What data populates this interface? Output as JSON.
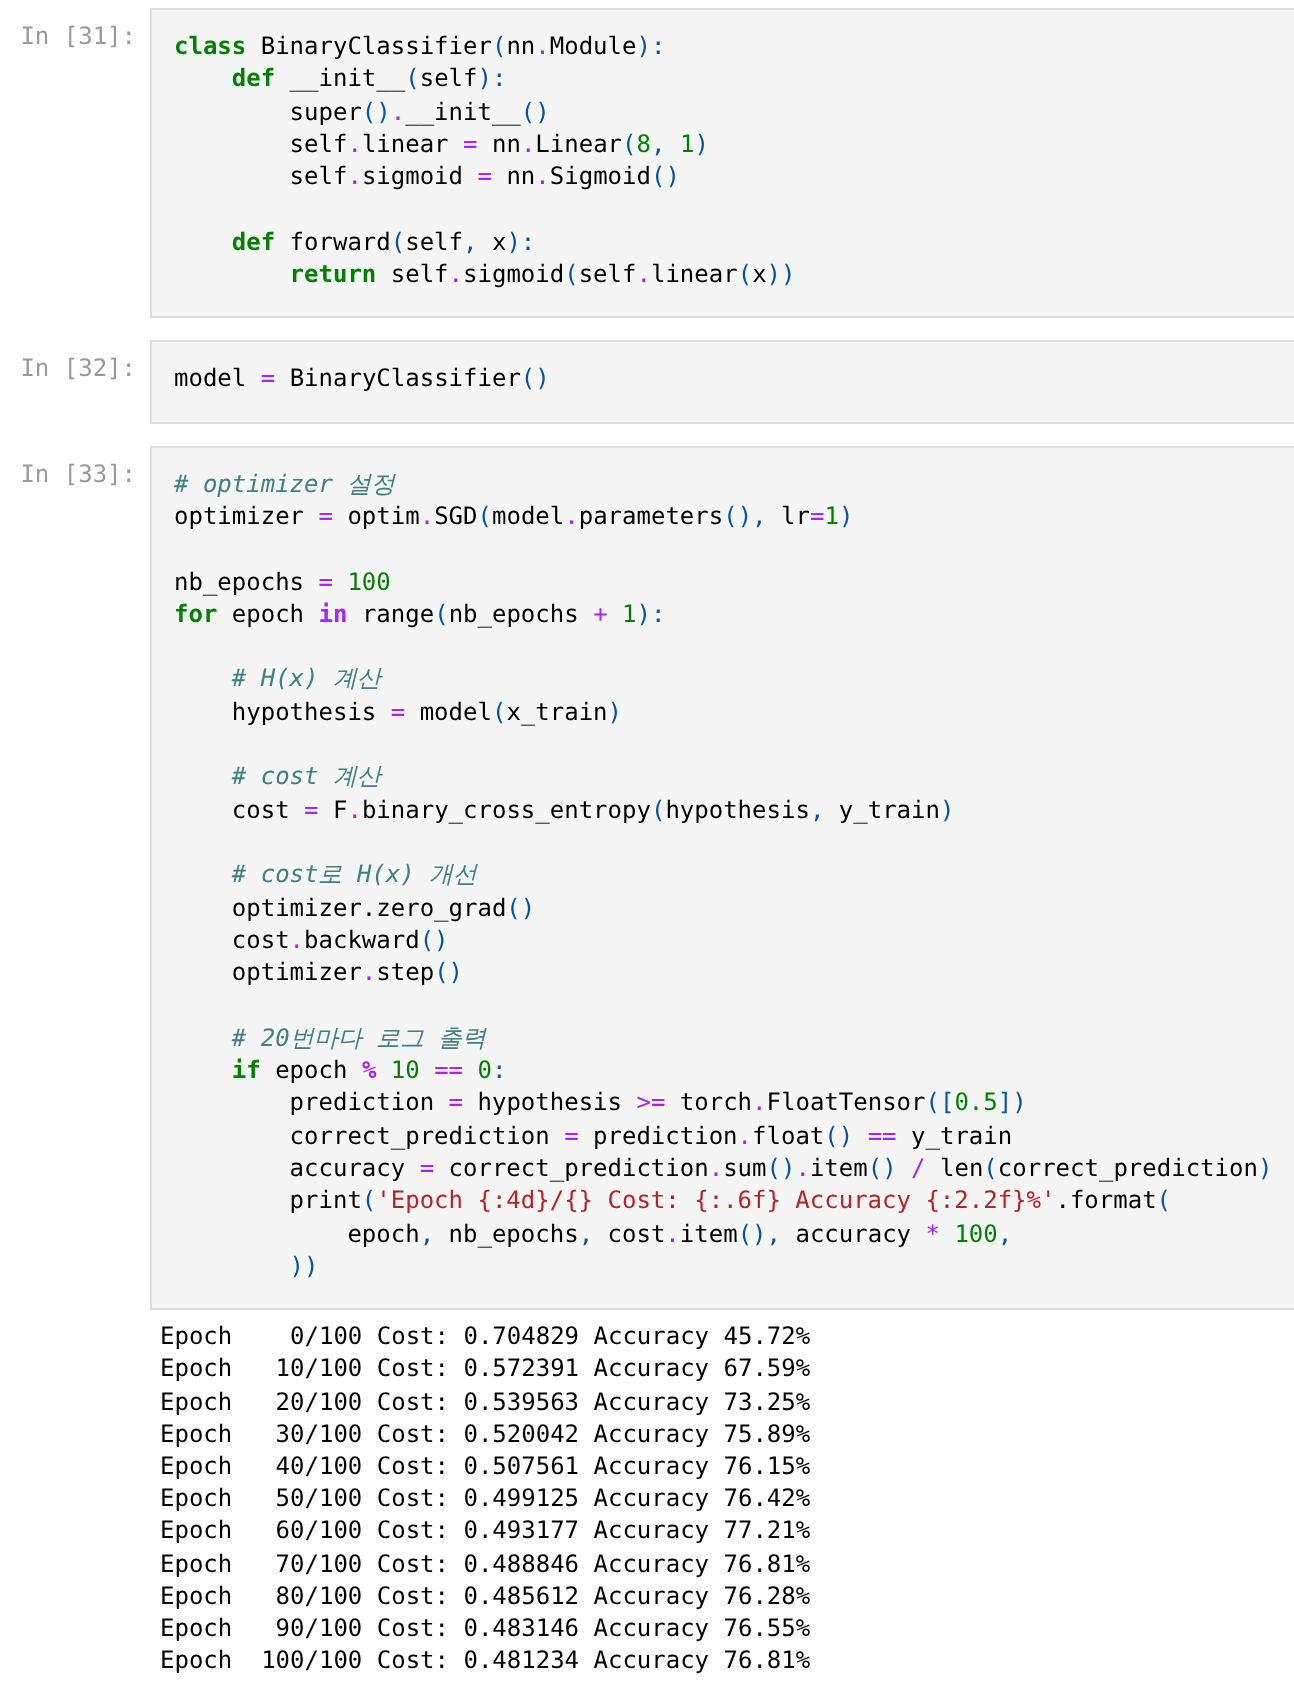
{
  "cells": [
    {
      "prompt": "In [31]:",
      "lines": [
        {
          "kind": "code",
          "tokens": [
            {
              "kind": "keyword",
              "text": "class"
            },
            {
              "kind": "plain",
              "text": " BinaryClassifier"
            },
            {
              "kind": "punct",
              "text": "("
            },
            {
              "kind": "plain",
              "text": "nn"
            },
            {
              "kind": "operator",
              "text": "."
            },
            {
              "kind": "plain",
              "text": "Module"
            },
            {
              "kind": "punct",
              "text": "):"
            }
          ]
        },
        {
          "kind": "code",
          "tokens": [
            {
              "kind": "keyword",
              "text": "    def"
            },
            {
              "kind": "plain",
              "text": " __init__"
            },
            {
              "kind": "punct",
              "text": "("
            },
            {
              "kind": "plain",
              "text": "self"
            },
            {
              "kind": "punct",
              "text": "):"
            }
          ]
        },
        {
          "kind": "code",
          "tokens": [
            {
              "kind": "plain",
              "text": "        super"
            },
            {
              "kind": "punct",
              "text": "()"
            },
            {
              "kind": "operator",
              "text": "."
            },
            {
              "kind": "plain",
              "text": "__init__"
            },
            {
              "kind": "punct",
              "text": "()"
            }
          ]
        },
        {
          "kind": "code",
          "tokens": [
            {
              "kind": "plain",
              "text": "        self"
            },
            {
              "kind": "operator",
              "text": "."
            },
            {
              "kind": "plain",
              "text": "linear "
            },
            {
              "kind": "operator",
              "text": "="
            },
            {
              "kind": "plain",
              "text": " nn"
            },
            {
              "kind": "operator",
              "text": "."
            },
            {
              "kind": "plain",
              "text": "Linear"
            },
            {
              "kind": "punct",
              "text": "("
            },
            {
              "kind": "number",
              "text": "8"
            },
            {
              "kind": "punct",
              "text": ", "
            },
            {
              "kind": "number",
              "text": "1"
            },
            {
              "kind": "punct",
              "text": ")"
            }
          ]
        },
        {
          "kind": "code",
          "tokens": [
            {
              "kind": "plain",
              "text": "        self"
            },
            {
              "kind": "operator",
              "text": "."
            },
            {
              "kind": "plain",
              "text": "sigmoid "
            },
            {
              "kind": "operator",
              "text": "="
            },
            {
              "kind": "plain",
              "text": " nn"
            },
            {
              "kind": "operator",
              "text": "."
            },
            {
              "kind": "plain",
              "text": "Sigmoid"
            },
            {
              "kind": "punct",
              "text": "()"
            }
          ]
        },
        {
          "kind": "blank"
        },
        {
          "kind": "code",
          "tokens": [
            {
              "kind": "keyword",
              "text": "    def"
            },
            {
              "kind": "plain",
              "text": " forward"
            },
            {
              "kind": "punct",
              "text": "("
            },
            {
              "kind": "plain",
              "text": "self"
            },
            {
              "kind": "punct",
              "text": ", "
            },
            {
              "kind": "plain",
              "text": "x"
            },
            {
              "kind": "punct",
              "text": "):"
            }
          ]
        },
        {
          "kind": "code",
          "tokens": [
            {
              "kind": "keyword",
              "text": "        return"
            },
            {
              "kind": "plain",
              "text": " self"
            },
            {
              "kind": "operator",
              "text": "."
            },
            {
              "kind": "plain",
              "text": "sigmoid"
            },
            {
              "kind": "punct",
              "text": "("
            },
            {
              "kind": "plain",
              "text": "self"
            },
            {
              "kind": "operator",
              "text": "."
            },
            {
              "kind": "plain",
              "text": "linear"
            },
            {
              "kind": "punct",
              "text": "("
            },
            {
              "kind": "plain",
              "text": "x"
            },
            {
              "kind": "punct",
              "text": "))"
            }
          ]
        }
      ]
    },
    {
      "prompt": "In [32]:",
      "lines": [
        {
          "kind": "code",
          "tokens": [
            {
              "kind": "plain",
              "text": "model "
            },
            {
              "kind": "operator",
              "text": "="
            },
            {
              "kind": "plain",
              "text": " BinaryClassifier"
            },
            {
              "kind": "punct",
              "text": "()"
            }
          ]
        }
      ]
    },
    {
      "prompt": "In [33]:",
      "lines": [
        {
          "kind": "code",
          "tokens": [
            {
              "kind": "comment",
              "text": "# optimizer 설정"
            }
          ]
        },
        {
          "kind": "code",
          "tokens": [
            {
              "kind": "plain",
              "text": "optimizer "
            },
            {
              "kind": "operator",
              "text": "="
            },
            {
              "kind": "plain",
              "text": " optim"
            },
            {
              "kind": "operator",
              "text": "."
            },
            {
              "kind": "plain",
              "text": "SGD"
            },
            {
              "kind": "punct",
              "text": "("
            },
            {
              "kind": "plain",
              "text": "model"
            },
            {
              "kind": "operator",
              "text": "."
            },
            {
              "kind": "plain",
              "text": "parameters"
            },
            {
              "kind": "punct",
              "text": "(), "
            },
            {
              "kind": "plain",
              "text": "lr"
            },
            {
              "kind": "operator",
              "text": "="
            },
            {
              "kind": "number",
              "text": "1"
            },
            {
              "kind": "punct",
              "text": ")"
            }
          ]
        },
        {
          "kind": "blank"
        },
        {
          "kind": "code",
          "tokens": [
            {
              "kind": "plain",
              "text": "nb_epochs "
            },
            {
              "kind": "operator",
              "text": "="
            },
            {
              "kind": "number",
              "text": " 100"
            }
          ]
        },
        {
          "kind": "code",
          "tokens": [
            {
              "kind": "keyword",
              "text": "for"
            },
            {
              "kind": "plain",
              "text": " epoch "
            },
            {
              "kind": "operator-word",
              "text": "in"
            },
            {
              "kind": "plain",
              "text": " range"
            },
            {
              "kind": "punct",
              "text": "("
            },
            {
              "kind": "plain",
              "text": "nb_epochs "
            },
            {
              "kind": "operator",
              "text": "+"
            },
            {
              "kind": "number",
              "text": " 1"
            },
            {
              "kind": "punct",
              "text": "):"
            }
          ]
        },
        {
          "kind": "blank"
        },
        {
          "kind": "code",
          "tokens": [
            {
              "kind": "comment",
              "text": "    # H(x) 계산"
            }
          ]
        },
        {
          "kind": "code",
          "tokens": [
            {
              "kind": "plain",
              "text": "    hypothesis "
            },
            {
              "kind": "operator",
              "text": "="
            },
            {
              "kind": "plain",
              "text": " model"
            },
            {
              "kind": "punct",
              "text": "("
            },
            {
              "kind": "plain",
              "text": "x_train"
            },
            {
              "kind": "punct",
              "text": ")"
            }
          ]
        },
        {
          "kind": "blank"
        },
        {
          "kind": "code",
          "tokens": [
            {
              "kind": "comment",
              "text": "    # cost 계산"
            }
          ]
        },
        {
          "kind": "code",
          "tokens": [
            {
              "kind": "plain",
              "text": "    cost "
            },
            {
              "kind": "operator",
              "text": "="
            },
            {
              "kind": "plain",
              "text": " F"
            },
            {
              "kind": "operator",
              "text": "."
            },
            {
              "kind": "plain",
              "text": "binary_cross_entropy"
            },
            {
              "kind": "punct",
              "text": "("
            },
            {
              "kind": "plain",
              "text": "hypothesis"
            },
            {
              "kind": "punct",
              "text": ", "
            },
            {
              "kind": "plain",
              "text": "y_train"
            },
            {
              "kind": "punct",
              "text": ")"
            }
          ]
        },
        {
          "kind": "blank"
        },
        {
          "kind": "code",
          "tokens": [
            {
              "kind": "comment",
              "text": "    # cost로 H(x) 개선"
            }
          ]
        },
        {
          "kind": "code",
          "tokens": [
            {
              "kind": "plain",
              "text": "    optimizer.zero_grad"
            },
            {
              "kind": "punct",
              "text": "()"
            }
          ]
        },
        {
          "kind": "code",
          "tokens": [
            {
              "kind": "plain",
              "text": "    cost"
            },
            {
              "kind": "operator",
              "text": "."
            },
            {
              "kind": "plain",
              "text": "backward"
            },
            {
              "kind": "punct",
              "text": "()"
            }
          ]
        },
        {
          "kind": "code",
          "tokens": [
            {
              "kind": "plain",
              "text": "    optimizer"
            },
            {
              "kind": "operator",
              "text": "."
            },
            {
              "kind": "plain",
              "text": "step"
            },
            {
              "kind": "punct",
              "text": "()"
            }
          ]
        },
        {
          "kind": "blank"
        },
        {
          "kind": "code",
          "tokens": [
            {
              "kind": "comment",
              "text": "    # 20번마다 로그 출력"
            }
          ]
        },
        {
          "kind": "code",
          "tokens": [
            {
              "kind": "keyword",
              "text": "    if"
            },
            {
              "kind": "plain",
              "text": " epoch "
            },
            {
              "kind": "operator-word",
              "text": "%"
            },
            {
              "kind": "number",
              "text": " 10 "
            },
            {
              "kind": "operator",
              "text": "=="
            },
            {
              "kind": "number",
              "text": " 0"
            },
            {
              "kind": "punct",
              "text": ":"
            }
          ]
        },
        {
          "kind": "code",
          "tokens": [
            {
              "kind": "plain",
              "text": "        prediction "
            },
            {
              "kind": "operator",
              "text": "="
            },
            {
              "kind": "plain",
              "text": " hypothesis "
            },
            {
              "kind": "operator",
              "text": ">="
            },
            {
              "kind": "plain",
              "text": " torch"
            },
            {
              "kind": "operator",
              "text": "."
            },
            {
              "kind": "plain",
              "text": "FloatTensor"
            },
            {
              "kind": "punct",
              "text": "(["
            },
            {
              "kind": "number",
              "text": "0.5"
            },
            {
              "kind": "punct",
              "text": "])"
            }
          ]
        },
        {
          "kind": "code",
          "tokens": [
            {
              "kind": "plain",
              "text": "        correct_prediction "
            },
            {
              "kind": "operator",
              "text": "="
            },
            {
              "kind": "plain",
              "text": " prediction"
            },
            {
              "kind": "operator",
              "text": "."
            },
            {
              "kind": "plain",
              "text": "float"
            },
            {
              "kind": "punct",
              "text": "()"
            },
            {
              "kind": "operator",
              "text": " =="
            },
            {
              "kind": "plain",
              "text": " y_train"
            }
          ]
        },
        {
          "kind": "code",
          "tokens": [
            {
              "kind": "plain",
              "text": "        accuracy "
            },
            {
              "kind": "operator",
              "text": "="
            },
            {
              "kind": "plain",
              "text": " correct_prediction"
            },
            {
              "kind": "operator",
              "text": "."
            },
            {
              "kind": "plain",
              "text": "sum"
            },
            {
              "kind": "punct",
              "text": "()"
            },
            {
              "kind": "operator",
              "text": "."
            },
            {
              "kind": "plain",
              "text": "item"
            },
            {
              "kind": "punct",
              "text": "()"
            },
            {
              "kind": "operator",
              "text": " /"
            },
            {
              "kind": "plain",
              "text": " len"
            },
            {
              "kind": "punct",
              "text": "("
            },
            {
              "kind": "plain",
              "text": "correct_prediction"
            },
            {
              "kind": "punct",
              "text": ")"
            }
          ]
        },
        {
          "kind": "code",
          "tokens": [
            {
              "kind": "plain",
              "text": "        print"
            },
            {
              "kind": "punct",
              "text": "("
            },
            {
              "kind": "string",
              "text": "'Epoch {:4d}/{} Cost: {:.6f} Accuracy {:2.2f}%'"
            },
            {
              "kind": "plain",
              "text": ".format"
            },
            {
              "kind": "punct",
              "text": "("
            }
          ]
        },
        {
          "kind": "code",
          "tokens": [
            {
              "kind": "plain",
              "text": "            epoch"
            },
            {
              "kind": "punct",
              "text": ", "
            },
            {
              "kind": "plain",
              "text": "nb_epochs"
            },
            {
              "kind": "punct",
              "text": ", "
            },
            {
              "kind": "plain",
              "text": "cost"
            },
            {
              "kind": "operator",
              "text": "."
            },
            {
              "kind": "plain",
              "text": "item"
            },
            {
              "kind": "punct",
              "text": "(), "
            },
            {
              "kind": "plain",
              "text": "accuracy "
            },
            {
              "kind": "operator",
              "text": "*"
            },
            {
              "kind": "number",
              "text": " 100"
            },
            {
              "kind": "punct",
              "text": ","
            }
          ]
        },
        {
          "kind": "code",
          "tokens": [
            {
              "kind": "punct",
              "text": "        ))"
            }
          ]
        }
      ],
      "output": [
        "Epoch    0/100 Cost: 0.704829 Accuracy 45.72%",
        "Epoch   10/100 Cost: 0.572391 Accuracy 67.59%",
        "Epoch   20/100 Cost: 0.539563 Accuracy 73.25%",
        "Epoch   30/100 Cost: 0.520042 Accuracy 75.89%",
        "Epoch   40/100 Cost: 0.507561 Accuracy 76.15%",
        "Epoch   50/100 Cost: 0.499125 Accuracy 76.42%",
        "Epoch   60/100 Cost: 0.493177 Accuracy 77.21%",
        "Epoch   70/100 Cost: 0.488846 Accuracy 76.81%",
        "Epoch   80/100 Cost: 0.485612 Accuracy 76.28%",
        "Epoch   90/100 Cost: 0.483146 Accuracy 76.55%",
        "Epoch  100/100 Cost: 0.481234 Accuracy 76.81%"
      ]
    }
  ]
}
